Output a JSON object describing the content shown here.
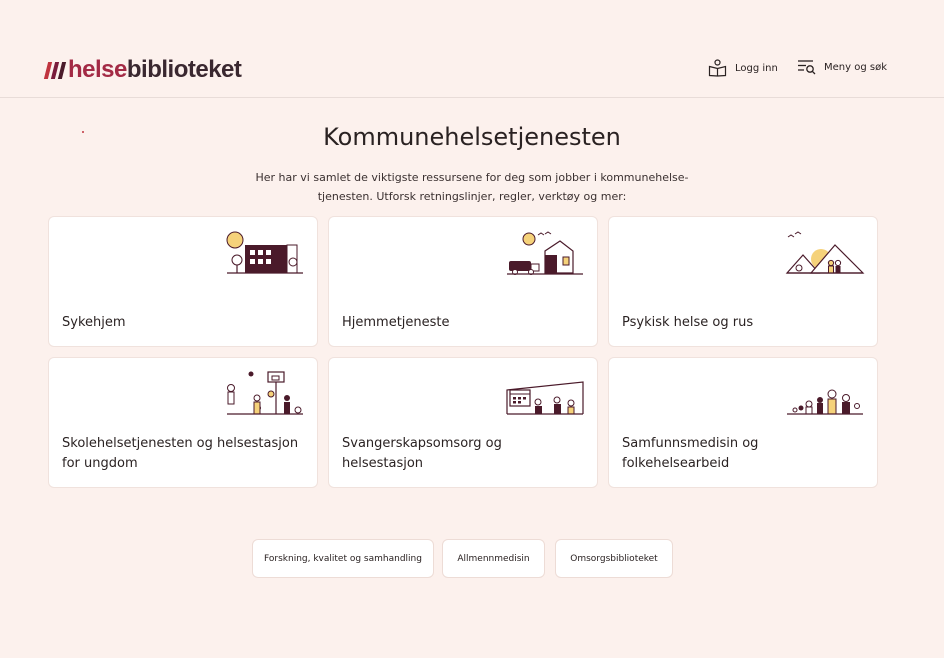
{
  "header": {
    "logo_helse": "helse",
    "logo_bibliotek": "biblioteket",
    "login_label": "Logg inn",
    "menu_label": "Meny og søk"
  },
  "main": {
    "title": "Kommunehelsetjenesten",
    "intro": "Her har vi samlet de viktigste ressursene for deg som jobber i kommunehelse-tjenesten. Utforsk retningslinjer, regler, verktøy og mer:"
  },
  "cards": [
    {
      "label": "Sykehjem",
      "icon": "nursing-home-illustration"
    },
    {
      "label": "Hjemmetjeneste",
      "icon": "home-care-illustration"
    },
    {
      "label": "Psykisk helse og rus",
      "icon": "mental-health-illustration"
    },
    {
      "label": "Skolehelsetjenesten og helsestasjon for ungdom",
      "icon": "school-health-illustration"
    },
    {
      "label": "Svangerskapsomsorg og helsestasjon",
      "icon": "maternity-care-illustration"
    },
    {
      "label": "Samfunnsmedisin og folkehelsearbeid",
      "icon": "public-health-illustration"
    }
  ],
  "links": [
    {
      "label": "Forskning, kvalitet og samhandling"
    },
    {
      "label": "Allmennmedisin"
    },
    {
      "label": "Omsorgsbiblioteket"
    }
  ],
  "colors": {
    "background": "#fcf1ed",
    "brand_red": "#a32a45",
    "illustration_dark": "#4a1a2a",
    "illustration_yellow": "#f5d27a"
  }
}
